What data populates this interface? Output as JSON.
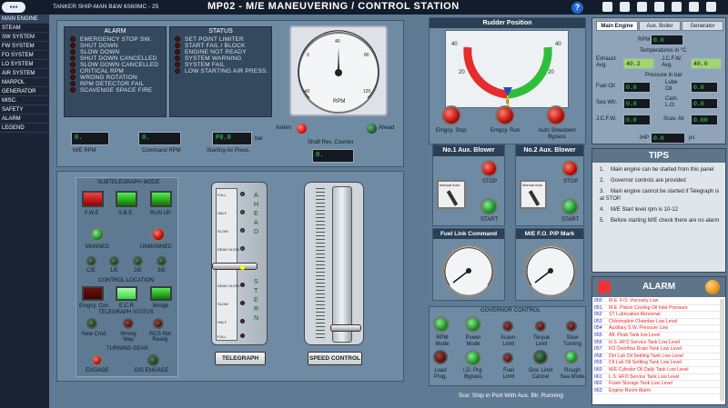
{
  "header": {
    "logo": "Logo",
    "ship": "TANKER SHIP-MAN B&W 6S60MC - 25",
    "title": "MP02 - M/E MANEUVERING / CONTROL STATION",
    "help": "?"
  },
  "sidebar": {
    "items": [
      "MAIN ENGINE",
      "STEAM",
      "SW SYSTEM",
      "FW SYSTEM",
      "FO SYSTEM",
      "LO SYSTEM",
      "AIR SYSTEM",
      "MARPOL",
      "GENERATOR",
      "MISC.",
      "SAFETY",
      "ALARM",
      "LEGEND"
    ]
  },
  "alarm_panel": {
    "title": "ALARM",
    "items": [
      "EMERGENCY STOP SW.",
      "SHUT DOWN",
      "SLOW DOWN",
      "SHUT DOWN CANCELLED",
      "SLOW DOWN CANCELLED",
      "CRITICAL RPM",
      "WRONG ROTATION",
      "RPM DETECTOR FAIL",
      "SCAVENGE SPACE FIRE"
    ]
  },
  "status_panel": {
    "title": "STATUS",
    "items": [
      "SET POINT LIMITER",
      "START FAIL / BLOCK",
      "ENGINE NOT READY",
      "SYSTEM WARNING",
      "SYSTEM FAIL",
      "LOW STARTING AIR PRESS."
    ]
  },
  "rpm_gauge": {
    "label": "RPM",
    "ticks": [
      "-40",
      "0",
      "40",
      "80",
      "120"
    ]
  },
  "readouts": {
    "me_rpm": {
      "value": "0.",
      "label": "M/E RPM"
    },
    "command_rpm": {
      "value": "0.",
      "label": "Command RPM"
    },
    "start_air": {
      "value": "P0.0",
      "unit": "bar",
      "label": "Starting Air Press."
    },
    "shaft_rev": {
      "value": "0.",
      "label": "Shaft Rev. Counter"
    }
  },
  "direction": {
    "astern": "Astern",
    "ahead": "Ahead"
  },
  "subtelegraph": {
    "title": "SUBTELEGRAPH MODE",
    "fwe": "F.W.E",
    "sbe": "S.B.E.",
    "runup": "RUN UP",
    "manned": "MANNED",
    "unmanned": "UNMANNED",
    "levels": [
      "C/E",
      "1/E",
      "2/E",
      "3/E"
    ]
  },
  "control_location": {
    "title": "CONTROL LOCATION",
    "items": [
      "Emgcy. Con.",
      "E.C.R.",
      "Bridge"
    ]
  },
  "telegraph_status": {
    "title": "TELEGRAPH STATUS",
    "items": [
      "New Cmd.",
      "Wrong Way",
      "RCS Not Ready"
    ]
  },
  "turning_gear": {
    "title": "TURNING GEAR",
    "engage": "ENGAGE",
    "disengage": "DIS ENGAGE"
  },
  "telegraph": {
    "button": "TELEGRAPH",
    "ahead": "AHEAD",
    "stern": "STERN",
    "scale": [
      "FULL",
      "HALF",
      "SLOW",
      "DEAD SLOW",
      "STOP",
      "DEAD SLOW",
      "SLOW",
      "HALF",
      "FULL"
    ]
  },
  "speed_control": {
    "button": "SPEED CONTROL"
  },
  "rudder": {
    "title": "Rudder Position",
    "ticks": [
      "40",
      "20",
      "0",
      "20",
      "40"
    ],
    "buttons": [
      "Emgcy. Stop",
      "Emgcy. Run",
      "Auto Slowdown Bypass"
    ]
  },
  "blower1": {
    "title": "No.1 Aux. Blower",
    "switch": "Manual Auto",
    "stop": "STOP",
    "start": "START"
  },
  "blower2": {
    "title": "No.2 Aux. Blower",
    "switch": "Manual Auto",
    "stop": "STOP",
    "start": "START"
  },
  "fuel_link": {
    "title": "Fuel Link Command"
  },
  "me_fo": {
    "title": "M/E F.O. P/P Mark"
  },
  "governor": {
    "title": "GOVERNOR CONTROL",
    "items": [
      "RPM Mode",
      "Power Mode",
      "Scavn. Limit",
      "Torque Limit",
      "Slow Turning",
      "Load Prog.",
      "I.D. Prg. Bypass",
      "Fuel Limit",
      "Gov. Limit Cancel",
      "Rough Sea Mode"
    ]
  },
  "right_panel": {
    "tabs": [
      "Main Engine",
      "Aux. Boiler",
      "Generator"
    ],
    "rpm_label": "RPM",
    "rpm_value": "0.0",
    "temps_title": "Temperatures in °C",
    "exhaust_label": "Exhaust Avg.",
    "exhaust_value": "40.2",
    "jcfw_label": "J.C.F.W. Avg.",
    "jcfw_value": "40.0",
    "press_title": "Pressure in bar",
    "fuel_oil_label": "Fuel Oil",
    "fuel_oil_value": "0.0",
    "lube_oil_label": "Lube Oil",
    "lube_oil_value": "0.0",
    "sea_wtr_label": "Sea Wtr.",
    "sea_wtr_value": "0.0",
    "cam_lo_label": "Cam. L.O.",
    "cam_lo_value": "0.0",
    "jcfw2_label": "J.C.F.W.",
    "jcfw2_value": "0.0",
    "scav_label": "Scav. Air",
    "scav_value": "0.00",
    "ihp_label": "IHP",
    "ihp_value": "0.0",
    "ihp_unit": "ps"
  },
  "tips": {
    "title": "TIPS",
    "items": [
      "Main engine can be started from this panel",
      "Governor controls are provided",
      "Main engine cannot be started if Telegraph is at STOP.",
      "M/E Start level rpm is 10-12",
      "Before starting M/E check there are no alarm"
    ]
  },
  "alarm_list": {
    "title": "ALARM",
    "rows": [
      [
        "050",
        "M.E. F.O. Viscosity Low"
      ],
      [
        "051",
        "M.E. Piston Cooling Oil Inlet Pressure"
      ],
      [
        "052",
        "ST Lubrication Abnormal"
      ],
      [
        "053",
        "Chlorination Chamber Low Level"
      ],
      [
        "054",
        "Auxiliary S.W. Pressure Low"
      ],
      [
        "055",
        "Aft. Peak Tank low Level"
      ],
      [
        "056",
        "H.S. HFO Service Tank Low Level"
      ],
      [
        "057",
        "FO Overflow Drain Tank Low Level"
      ],
      [
        "058",
        "Dirt Lub Oil Settling Tank Low Level"
      ],
      [
        "059",
        "Clt Lub Oil Settling Tank Low Level"
      ],
      [
        "060",
        "M/E Cylinder Oil Daily Tank Low Level"
      ],
      [
        "061",
        "L.S. HFO Service Tank Low Level"
      ],
      [
        "062",
        "Foam Storage Tank Low Level"
      ],
      [
        "063",
        "Engine Room Alarm"
      ]
    ]
  },
  "status_bar": "Sce: Ship in Port With Aux. Blr. Running"
}
